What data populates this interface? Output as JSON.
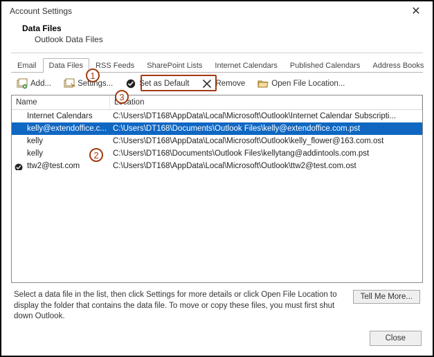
{
  "window": {
    "title": "Account Settings"
  },
  "header": {
    "title": "Data Files",
    "subtitle": "Outlook Data Files"
  },
  "tabs": [
    {
      "label": "Email"
    },
    {
      "label": "Data Files"
    },
    {
      "label": "RSS Feeds"
    },
    {
      "label": "SharePoint Lists"
    },
    {
      "label": "Internet Calendars"
    },
    {
      "label": "Published Calendars"
    },
    {
      "label": "Address Books"
    }
  ],
  "active_tab_index": 1,
  "toolbar": {
    "add": "Add...",
    "settings": "Settings...",
    "set_default": "Set as Default",
    "remove": "Remove",
    "open_location": "Open File Location..."
  },
  "table": {
    "columns": {
      "name": "Name",
      "location": "Location"
    },
    "rows": [
      {
        "name": "Internet Calendars",
        "location": "C:\\Users\\DT168\\AppData\\Local\\Microsoft\\Outlook\\Internet Calendar Subscripti...",
        "default": false
      },
      {
        "name": "kelly@extendoffice.c...",
        "location": "C:\\Users\\DT168\\Documents\\Outlook Files\\kelly@extendoffice.com.pst",
        "default": false
      },
      {
        "name": "kelly",
        "location": "C:\\Users\\DT168\\AppData\\Local\\Microsoft\\Outlook\\kelly_flower@163.com.ost",
        "default": false
      },
      {
        "name": "kelly",
        "location": "C:\\Users\\DT168\\Documents\\Outlook Files\\kellytang@addintools.com.pst",
        "default": false
      },
      {
        "name": "ttw2@test.com",
        "location": "C:\\Users\\DT168\\AppData\\Local\\Microsoft\\Outlook\\ttw2@test.com.ost",
        "default": true
      }
    ],
    "selected_index": 1
  },
  "info": {
    "text": "Select a data file in the list, then click Settings for more details or click Open File Location to display the folder that contains the data file. To move or copy these files, you must first shut down Outlook.",
    "tell_more": "Tell Me More..."
  },
  "footer": {
    "close": "Close"
  },
  "callouts": {
    "1": "1",
    "2": "2",
    "3": "3"
  }
}
